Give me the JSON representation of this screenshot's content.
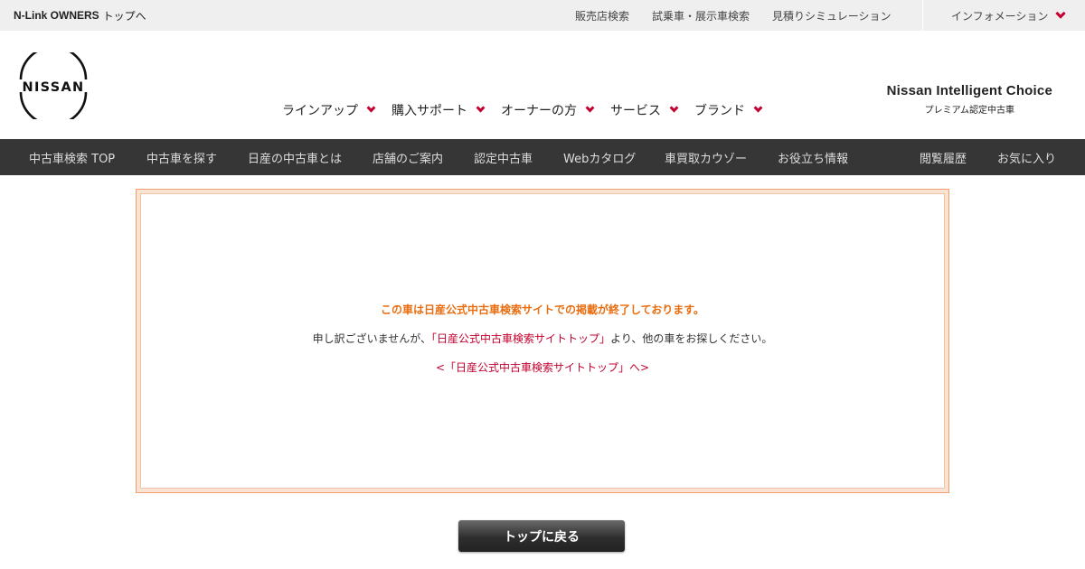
{
  "util_bar": {
    "owners_brand": "N-Link OWNERS",
    "owners_suffix": "トップへ",
    "links": [
      "販売店検索",
      "試乗車・展示車検索",
      "見積りシミュレーション"
    ],
    "info_label": "インフォメーション"
  },
  "header": {
    "logo_text": "NISSAN",
    "nav": [
      "ラインアップ",
      "購入サポート",
      "オーナーの方",
      "サービス",
      "ブランド"
    ],
    "nic_title": "Nissan Intelligent Choice",
    "nic_subtitle": "プレミアム認定中古車"
  },
  "dark_nav": {
    "items": [
      "中古車検索 TOP",
      "中古車を探す",
      "日産の中古車とは",
      "店舗のご案内",
      "認定中古車",
      "Webカタログ",
      "車買取カウゾー",
      "お役立ち情報"
    ],
    "right_items": [
      "閲覧履歴",
      "お気に入り"
    ]
  },
  "notice": {
    "title": "この車は日産公式中古車検索サイトでの掲載が終了しております。",
    "msg_before": "申し訳ございませんが、",
    "msg_link": "「日産公式中古車検索サイトトップ」",
    "msg_after": "より、他の車をお探しください。",
    "back_link": "<「日産公式中古車検索サイトトップ」へ>"
  },
  "back_button": "トップに戻る",
  "colors": {
    "accent": "#c3002f",
    "notice_orange": "#e86d10",
    "dark_nav_bg": "#363636"
  }
}
